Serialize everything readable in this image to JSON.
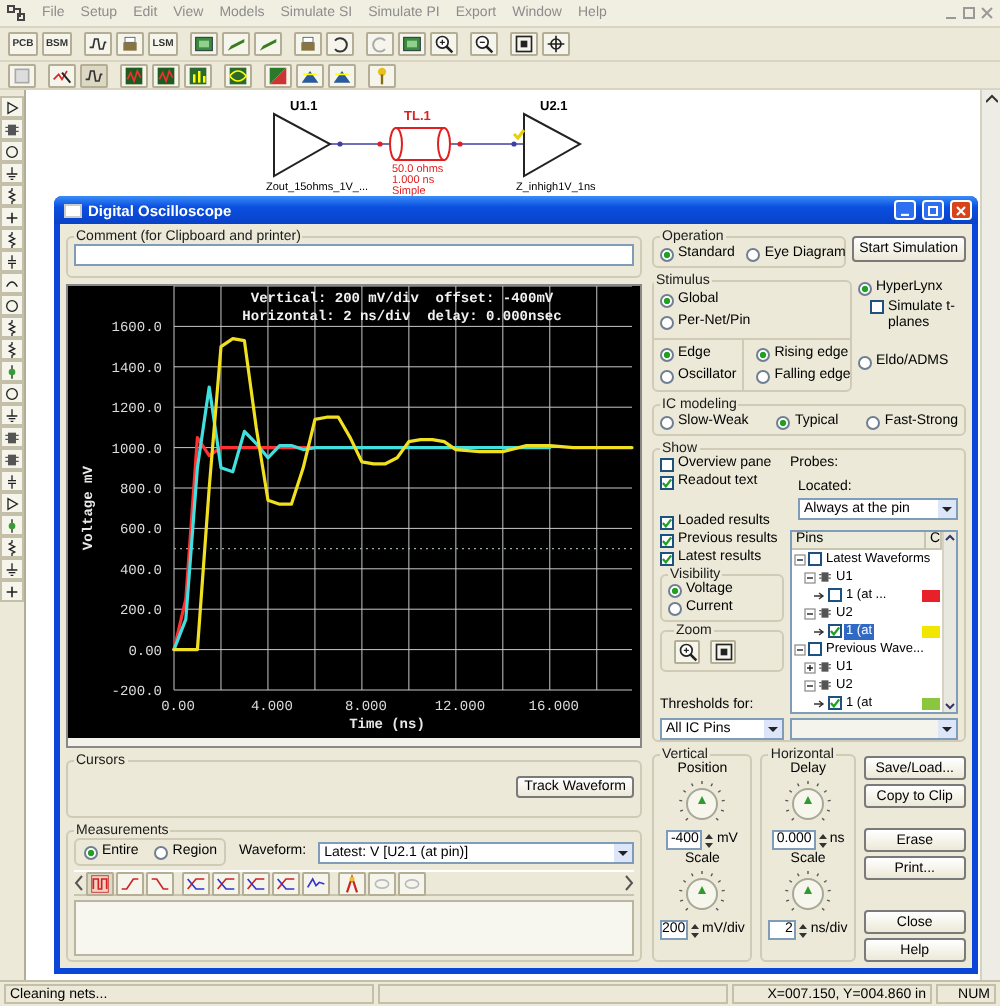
{
  "app": {
    "menu": [
      "File",
      "Setup",
      "Edit",
      "View",
      "Models",
      "Simulate SI",
      "Simulate PI",
      "Export",
      "Window",
      "Help"
    ],
    "toolbar_labels": [
      "PCB",
      "BSM",
      "LSM"
    ],
    "status_bar": {
      "message": "Cleaning nets...",
      "coordinates": "X=007.150, Y=004.860 in",
      "indicator": "NUM"
    }
  },
  "schematic": {
    "parts": [
      {
        "kind": "buffer",
        "ref": "U1.1",
        "model": "Zout_15ohms_1V_..."
      },
      {
        "kind": "transmission_line",
        "ref": "TL.1",
        "lines": [
          "50.0 ohms",
          "1.000 ns",
          "Simple"
        ]
      },
      {
        "kind": "buffer",
        "ref": "U2.1",
        "model": "Z_inhigh1V_1ns"
      }
    ]
  },
  "dialog": {
    "title": "Digital Oscilloscope",
    "comment": {
      "label": "Comment (for Clipboard and printer)"
    },
    "scope": {
      "readout": [
        "Vertical: 200 mV/div  offset: -400mV",
        "Horizontal: 2 ns/div  delay: 0.000nsec"
      ],
      "chart_data": {
        "type": "line",
        "xlabel": "Time  (ns)",
        "ylabel": "Voltage mV",
        "xlim": [
          0,
          19.5
        ],
        "ylim": [
          -200,
          1800
        ],
        "xticks": [
          {
            "value": 0,
            "label": "0.00"
          },
          {
            "value": 4,
            "label": "4.000"
          },
          {
            "value": 8,
            "label": "8.000"
          },
          {
            "value": 12,
            "label": "12.000"
          },
          {
            "value": 16,
            "label": "16.000"
          }
        ],
        "yticks": [
          {
            "value": -200,
            "label": "-200.0"
          },
          {
            "value": 0,
            "label": "0.00"
          },
          {
            "value": 200,
            "label": "200.0"
          },
          {
            "value": 400,
            "label": "400.0"
          },
          {
            "value": 600,
            "label": "600.0"
          },
          {
            "value": 800,
            "label": "800.0"
          },
          {
            "value": 1000,
            "label": "1000.0"
          },
          {
            "value": 1200,
            "label": "1200.0"
          },
          {
            "value": 1400,
            "label": "1400.0"
          },
          {
            "value": 1600,
            "label": "1600.0"
          }
        ],
        "x": [
          0,
          0.5,
          1,
          1.5,
          2,
          2.5,
          3,
          3.5,
          4,
          4.5,
          5,
          5.5,
          6,
          6.5,
          7,
          7.5,
          8,
          8.5,
          9,
          9.5,
          10,
          10.5,
          11,
          11.5,
          12,
          13,
          14,
          15,
          16,
          17,
          18,
          19,
          19.5
        ],
        "series": [
          {
            "color": "#ff3030",
            "values": [
              0,
              250,
              1050,
              960,
              1000,
              1000,
              1000,
              1000,
              1000,
              1000,
              1000,
              1000,
              1000,
              null,
              null,
              null,
              null,
              null,
              null,
              null,
              null,
              null,
              null,
              null,
              null,
              null,
              null,
              null,
              null,
              null,
              null,
              null,
              null
            ]
          },
          {
            "color": "#40e0e0",
            "values": [
              0,
              150,
              900,
              1300,
              900,
              880,
              1080,
              1020,
              950,
              1010,
              1010,
              990,
              1000,
              1000,
              1000,
              1000,
              1000,
              1000,
              1000,
              1000,
              1000,
              1000,
              1000,
              1000,
              1000,
              1000,
              1000,
              1000,
              1000,
              null,
              null,
              null,
              null
            ]
          },
          {
            "color": "#f0e020",
            "values": [
              0,
              0,
              0,
              800,
              1500,
              1540,
              1530,
              1100,
              740,
              720,
              720,
              900,
              1140,
              1150,
              1150,
              1050,
              930,
              920,
              920,
              950,
              1030,
              1040,
              1040,
              1030,
              990,
              980,
              980,
              1010,
              1010,
              1000,
              1000,
              1000,
              1000
            ]
          }
        ],
        "grid": true,
        "ref_lines": [
          {
            "axis": "y",
            "value": 500
          }
        ]
      }
    },
    "cursors": {
      "label": "Cursors",
      "button": "Track Waveform"
    },
    "measurements": {
      "label": "Measurements",
      "modes": [
        {
          "label": "Entire",
          "selected": true
        },
        {
          "label": "Region",
          "selected": false
        }
      ],
      "waveform_label": "Waveform:",
      "waveform": "Latest: V [U2.1 (at pin)]"
    },
    "operation": {
      "label": "Operation",
      "options": [
        {
          "label": "Standard",
          "selected": true
        },
        {
          "label": "Eye Diagram",
          "selected": false
        }
      ]
    },
    "start_button": "Start Simulation",
    "stimulus": {
      "label": "Stimulus",
      "scope_options": [
        {
          "label": "Global",
          "selected": true
        },
        {
          "label": "Per-Net/Pin",
          "selected": false
        }
      ],
      "type_options": [
        {
          "label": "Edge",
          "selected": true
        },
        {
          "label": "Oscillator",
          "selected": false
        }
      ],
      "edge_options": [
        {
          "label": "Rising edge",
          "selected": true
        },
        {
          "label": "Falling edge",
          "selected": false
        }
      ]
    },
    "simulators": [
      {
        "label": "HyperLynx",
        "selected": true
      },
      {
        "label": "Eldo/ADMS",
        "selected": false
      }
    ],
    "t_planes": {
      "label": "Simulate t-planes",
      "checked": false
    },
    "ic_modeling": {
      "label": "IC modeling",
      "options": [
        {
          "label": "Slow-Weak",
          "selected": false
        },
        {
          "label": "Typical",
          "selected": true
        },
        {
          "label": "Fast-Strong",
          "selected": false
        }
      ]
    },
    "show": {
      "label": "Show",
      "options": [
        {
          "label": "Overview pane",
          "checked": false
        },
        {
          "label": "Readout text",
          "checked": true
        }
      ],
      "results": [
        {
          "label": "Loaded results",
          "checked": true
        },
        {
          "label": "Previous results",
          "checked": true
        },
        {
          "label": "Latest results",
          "checked": true
        }
      ],
      "visibility": {
        "label": "Visibility",
        "options": [
          {
            "label": "Voltage",
            "selected": true
          },
          {
            "label": "Current",
            "selected": false
          }
        ]
      },
      "zoom_label": "Zoom",
      "probes_label": "Probes:",
      "located_label": "Located:",
      "located": "Always at the pin",
      "pins_tree": {
        "columns": [
          "Pins",
          "C"
        ],
        "items": [
          {
            "kind": "group",
            "label": "Latest Waveforms",
            "checked": false,
            "expanded": true,
            "children": [
              {
                "kind": "part",
                "label": "U1",
                "expanded": true,
                "children": [
                  {
                    "kind": "pin",
                    "label": "1 (at ...",
                    "checked": false,
                    "selected": false,
                    "color": "#e8202a"
                  }
                ]
              },
              {
                "kind": "part",
                "label": "U2",
                "expanded": true,
                "children": [
                  {
                    "kind": "pin",
                    "label": "1 (at",
                    "checked": true,
                    "selected": true,
                    "color": "#f2e600"
                  }
                ]
              }
            ]
          },
          {
            "kind": "group",
            "label": "Previous Wave...",
            "checked": false,
            "expanded": true,
            "children": [
              {
                "kind": "part",
                "label": "U1",
                "expanded": false
              },
              {
                "kind": "part",
                "label": "U2",
                "expanded": true,
                "children": [
                  {
                    "kind": "pin",
                    "label": "1 (at",
                    "checked": true,
                    "selected": false,
                    "color": "#8cc63f"
                  }
                ]
              }
            ]
          }
        ]
      },
      "thresholds_label": "Thresholds for:",
      "thresholds": "All IC Pins"
    },
    "vertical": {
      "label": "Vertical",
      "sublabel": "Position",
      "value": "-400",
      "unit": "mV",
      "scale_label": "Scale",
      "scale": "200",
      "scale_unit": "mV/div"
    },
    "horizontal": {
      "label": "Horizontal",
      "sublabel": "Delay",
      "value": "0.000",
      "unit": "ns",
      "scale_label": "Scale",
      "scale": "2",
      "scale_unit": "ns/div"
    },
    "buttons": [
      "Save/Load...",
      "Copy to Clip",
      "Erase",
      "Print...",
      "Close",
      "Help"
    ]
  }
}
